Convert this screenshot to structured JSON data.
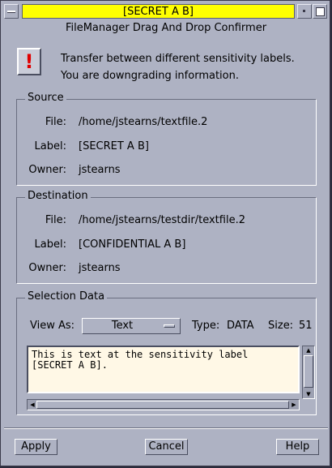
{
  "window": {
    "title": "[SECRET A B]",
    "subtitle": "FileManager Drag And Drop Confirmer",
    "title_color": "#ffff00"
  },
  "message": {
    "icon": "exclamation-icon",
    "line1": "Transfer between different sensitivity labels.",
    "line2": "You are downgrading information."
  },
  "source": {
    "heading": "Source",
    "file_label": "File:",
    "file": "/home/jstearns/textfile.2",
    "label_label": "Label:",
    "label": "[SECRET A B]",
    "owner_label": "Owner:",
    "owner": "jstearns"
  },
  "destination": {
    "heading": "Destination",
    "file_label": "File:",
    "file": "/home/jstearns/testdir/textfile.2",
    "label_label": "Label:",
    "label": "[CONFIDENTIAL A B]",
    "owner_label": "Owner:",
    "owner": "jstearns"
  },
  "selection": {
    "heading": "Selection Data",
    "view_as_label": "View As:",
    "view_as_value": "Text",
    "type_label": "Type:",
    "type_value": "DATA",
    "size_label": "Size:",
    "size_value": "51",
    "content": "This is text at the sensitivity label\n[SECRET A B]."
  },
  "buttons": {
    "apply": "Apply",
    "cancel": "Cancel",
    "help": "Help"
  }
}
